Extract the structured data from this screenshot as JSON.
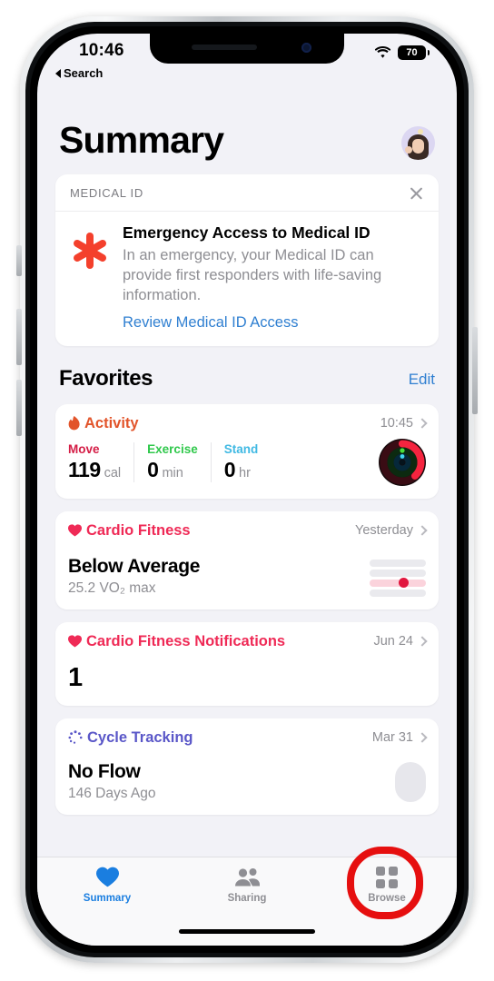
{
  "status_bar": {
    "time": "10:46",
    "back_label": "Search",
    "battery_level": "70",
    "wifi_icon": "wifi-icon",
    "battery_icon": "battery-icon"
  },
  "header": {
    "title": "Summary",
    "avatar_icon": "memoji-avatar"
  },
  "medical_id_card": {
    "section_label": "MEDICAL ID",
    "close_icon": "close-icon",
    "alert_icon": "medical-asterisk-icon",
    "title": "Emergency Access to Medical ID",
    "description": "In an emergency, your Medical ID can provide first responders with life-saving information.",
    "link_label": "Review Medical ID Access"
  },
  "favorites": {
    "title": "Favorites",
    "edit_label": "Edit",
    "cards": [
      {
        "name": "Activity",
        "icon": "flame-icon",
        "accent": "#e2542a",
        "timestamp": "10:45",
        "metrics": [
          {
            "label": "Move",
            "value": "119",
            "unit": "cal",
            "color": "#d41c45"
          },
          {
            "label": "Exercise",
            "value": "0",
            "unit": "min",
            "color": "#2fc84b"
          },
          {
            "label": "Stand",
            "value": "0",
            "unit": "hr",
            "color": "#40b9e3"
          }
        ],
        "rings_icon": "activity-rings-icon"
      },
      {
        "name": "Cardio Fitness",
        "icon": "heart-icon",
        "accent": "#ef2a56",
        "timestamp": "Yesterday",
        "main_value": "Below Average",
        "sub_value": "25.2 VO₂ max",
        "chart_icon": "cardio-level-bars-icon"
      },
      {
        "name": "Cardio Fitness Notifications",
        "icon": "heart-icon",
        "accent": "#ef2a56",
        "timestamp": "Jun 24",
        "main_value": "1"
      },
      {
        "name": "Cycle Tracking",
        "icon": "cycle-dots-icon",
        "accent": "#5a57c8",
        "timestamp": "Mar 31",
        "main_value": "No Flow",
        "sub_value": "146 Days Ago",
        "chart_icon": "cycle-blob-icon"
      }
    ]
  },
  "tab_bar": {
    "items": [
      {
        "label": "Summary",
        "icon": "heart-icon",
        "active": true
      },
      {
        "label": "Sharing",
        "icon": "people-icon",
        "active": false
      },
      {
        "label": "Browse",
        "icon": "grid-icon",
        "active": false
      }
    ]
  },
  "annotation": {
    "shape": "red-circle-highlight",
    "target": "Browse",
    "color": "#e60f0f"
  }
}
